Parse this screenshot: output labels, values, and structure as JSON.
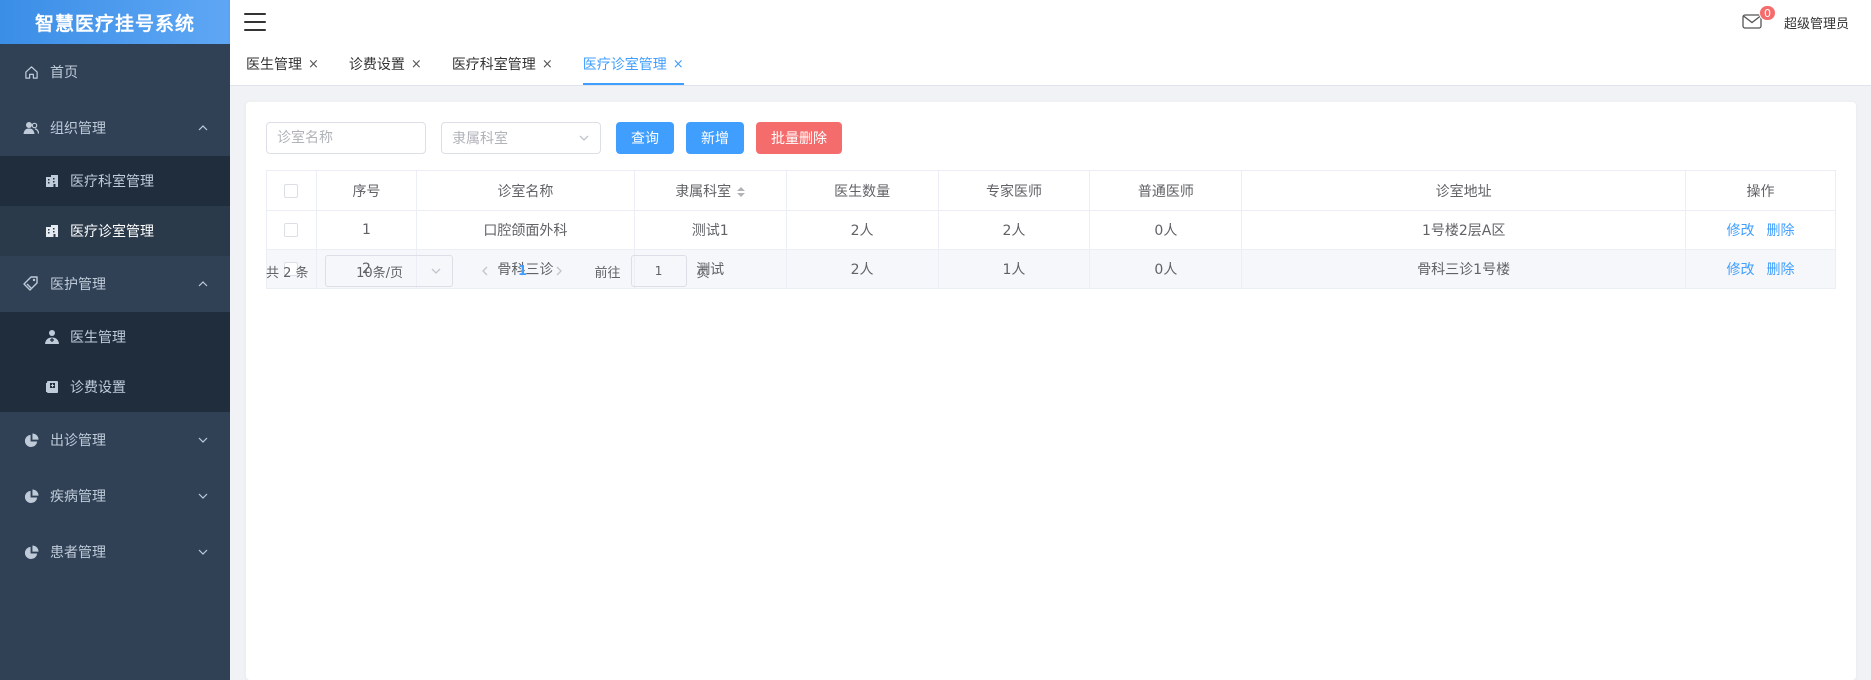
{
  "app": {
    "title": "智慧医疗挂号系统"
  },
  "header": {
    "mail_badge": "0",
    "user": "超级管理员"
  },
  "sidebar": {
    "items": [
      {
        "label": "首页",
        "icon": "home-icon"
      },
      {
        "label": "组织管理",
        "icon": "users-icon",
        "expanded": true,
        "children": [
          {
            "label": "医疗科室管理",
            "icon": "building-icon"
          },
          {
            "label": "医疗诊室管理",
            "icon": "building-icon",
            "active": true
          }
        ]
      },
      {
        "label": "医护管理",
        "icon": "tag-icon",
        "expanded": true,
        "children": [
          {
            "label": "医生管理",
            "icon": "doctor-icon"
          },
          {
            "label": "诊费设置",
            "icon": "book-icon"
          }
        ]
      },
      {
        "label": "出诊管理",
        "icon": "pie-icon"
      },
      {
        "label": "疾病管理",
        "icon": "pie-icon"
      },
      {
        "label": "患者管理",
        "icon": "pie-icon"
      }
    ]
  },
  "tabs": [
    {
      "label": "医生管理"
    },
    {
      "label": "诊费设置"
    },
    {
      "label": "医疗科室管理"
    },
    {
      "label": "医疗诊室管理",
      "active": true
    }
  ],
  "tab_close": "×",
  "toolbar": {
    "name_placeholder": "诊室名称",
    "dept_placeholder": "隶属科室",
    "query": "查询",
    "add": "新增",
    "batch_delete": "批量删除"
  },
  "table": {
    "headers": [
      "序号",
      "诊室名称",
      "隶属科室",
      "医生数量",
      "专家医师",
      "普通医师",
      "诊室地址",
      "操作"
    ],
    "rows": [
      {
        "no": "1",
        "name": "口腔颌面外科",
        "dept": "测试1",
        "doctors": "2人",
        "experts": "2人",
        "general": "0人",
        "address": "1号楼2层A区"
      },
      {
        "no": "2",
        "name": "骨科三诊",
        "dept": "测试",
        "doctors": "2人",
        "experts": "1人",
        "general": "0人",
        "address": "骨科三诊1号楼"
      }
    ],
    "edit": "修改",
    "delete": "删除"
  },
  "pagination": {
    "total": "共 2 条",
    "page_size": "10条/页",
    "current": "1",
    "goto_label": "前往",
    "goto_value": "1",
    "page_unit": "页"
  },
  "colors": {
    "sidebar": "#304156",
    "primary": "#409eff",
    "danger": "#f56c6c"
  }
}
